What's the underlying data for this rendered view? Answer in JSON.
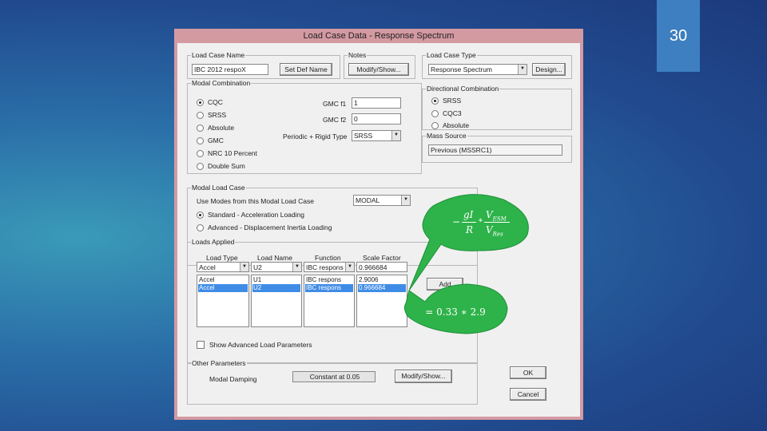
{
  "slide_number": "30",
  "dialog": {
    "title": "Load Case Data - Response Spectrum",
    "load_case_name": {
      "label": "Load Case Name",
      "value": "IBC 2012 respoX",
      "button": "Set Def Name"
    },
    "notes": {
      "label": "Notes",
      "button": "Modify/Show..."
    },
    "load_case_type": {
      "label": "Load Case Type",
      "value": "Response Spectrum",
      "button": "Design..."
    },
    "modal_combination": {
      "label": "Modal Combination",
      "options": [
        "CQC",
        "SRSS",
        "Absolute",
        "GMC",
        "NRC 10 Percent",
        "Double Sum"
      ],
      "selected": "CQC",
      "gmc_f1_label": "GMC  f1",
      "gmc_f1_value": "1",
      "gmc_f2_label": "GMC  f2",
      "gmc_f2_value": "0",
      "periodic_label": "Periodic + Rigid Type",
      "periodic_value": "SRSS"
    },
    "directional_combination": {
      "label": "Directional Combination",
      "options": [
        "SRSS",
        "CQC3",
        "Absolute"
      ],
      "selected": "SRSS"
    },
    "mass_source": {
      "label": "Mass Source",
      "value": "Previous (MSSRC1)"
    },
    "modal_load_case": {
      "label": "Modal Load Case",
      "use_modes_label": "Use Modes from this Modal Load Case",
      "use_modes_value": "MODAL",
      "options": [
        "Standard - Acceleration Loading",
        "Advanced - Displacement Inertia Loading"
      ],
      "selected": "Standard - Acceleration Loading"
    },
    "loads_applied": {
      "label": "Loads Applied",
      "headers": [
        "Load Type",
        "Load Name",
        "Function",
        "Scale Factor"
      ],
      "input_row": [
        "Accel",
        "U2",
        "IBC respons",
        "0.966684"
      ],
      "rows": [
        [
          "Accel",
          "U1",
          "IBC respons",
          "2.9006"
        ],
        [
          "Accel",
          "U2",
          "IBC respons",
          "0.966684"
        ]
      ],
      "add_button": "Add",
      "advanced_params_label": "Show Advanced Load Parameters"
    },
    "other_parameters": {
      "label": "Other Parameters",
      "modal_damping_label": "Modal Damping",
      "modal_damping_value": "Constant at 0.05",
      "button": "Modify/Show..."
    },
    "ok_button": "OK",
    "cancel_button": "Cancel"
  },
  "annotations": {
    "formula_top": {
      "lhs": "−",
      "g": "gI",
      "R": "R",
      "V_esm": "V",
      "V_esm_sub": "ESM",
      "V_res": "V",
      "V_res_sub": "Res"
    },
    "formula_bottom": "= 0.33 ∗ 2.9",
    "bubble_color": "#2eb34a"
  }
}
